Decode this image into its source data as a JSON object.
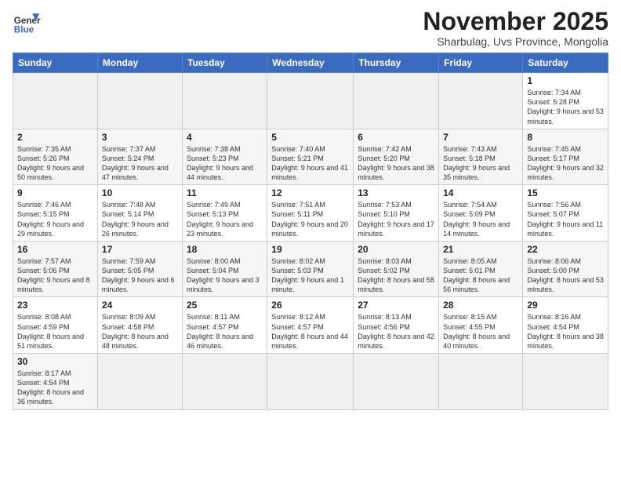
{
  "header": {
    "logo_general": "General",
    "logo_blue": "Blue",
    "month_title": "November 2025",
    "subtitle": "Sharbulag, Uvs Province, Mongolia"
  },
  "weekdays": [
    "Sunday",
    "Monday",
    "Tuesday",
    "Wednesday",
    "Thursday",
    "Friday",
    "Saturday"
  ],
  "weeks": [
    [
      {
        "day": "",
        "empty": true
      },
      {
        "day": "",
        "empty": true
      },
      {
        "day": "",
        "empty": true
      },
      {
        "day": "",
        "empty": true
      },
      {
        "day": "",
        "empty": true
      },
      {
        "day": "",
        "empty": true
      },
      {
        "day": "1",
        "info": "Sunrise: 7:34 AM\nSunset: 5:28 PM\nDaylight: 9 hours\nand 53 minutes."
      }
    ],
    [
      {
        "day": "2",
        "info": "Sunrise: 7:35 AM\nSunset: 5:26 PM\nDaylight: 9 hours\nand 50 minutes."
      },
      {
        "day": "3",
        "info": "Sunrise: 7:37 AM\nSunset: 5:24 PM\nDaylight: 9 hours\nand 47 minutes."
      },
      {
        "day": "4",
        "info": "Sunrise: 7:38 AM\nSunset: 5:23 PM\nDaylight: 9 hours\nand 44 minutes."
      },
      {
        "day": "5",
        "info": "Sunrise: 7:40 AM\nSunset: 5:21 PM\nDaylight: 9 hours\nand 41 minutes."
      },
      {
        "day": "6",
        "info": "Sunrise: 7:42 AM\nSunset: 5:20 PM\nDaylight: 9 hours\nand 38 minutes."
      },
      {
        "day": "7",
        "info": "Sunrise: 7:43 AM\nSunset: 5:18 PM\nDaylight: 9 hours\nand 35 minutes."
      },
      {
        "day": "8",
        "info": "Sunrise: 7:45 AM\nSunset: 5:17 PM\nDaylight: 9 hours\nand 32 minutes."
      }
    ],
    [
      {
        "day": "9",
        "info": "Sunrise: 7:46 AM\nSunset: 5:15 PM\nDaylight: 9 hours\nand 29 minutes."
      },
      {
        "day": "10",
        "info": "Sunrise: 7:48 AM\nSunset: 5:14 PM\nDaylight: 9 hours\nand 26 minutes."
      },
      {
        "day": "11",
        "info": "Sunrise: 7:49 AM\nSunset: 5:13 PM\nDaylight: 9 hours\nand 23 minutes."
      },
      {
        "day": "12",
        "info": "Sunrise: 7:51 AM\nSunset: 5:11 PM\nDaylight: 9 hours\nand 20 minutes."
      },
      {
        "day": "13",
        "info": "Sunrise: 7:53 AM\nSunset: 5:10 PM\nDaylight: 9 hours\nand 17 minutes."
      },
      {
        "day": "14",
        "info": "Sunrise: 7:54 AM\nSunset: 5:09 PM\nDaylight: 9 hours\nand 14 minutes."
      },
      {
        "day": "15",
        "info": "Sunrise: 7:56 AM\nSunset: 5:07 PM\nDaylight: 9 hours\nand 11 minutes."
      }
    ],
    [
      {
        "day": "16",
        "info": "Sunrise: 7:57 AM\nSunset: 5:06 PM\nDaylight: 9 hours\nand 8 minutes."
      },
      {
        "day": "17",
        "info": "Sunrise: 7:59 AM\nSunset: 5:05 PM\nDaylight: 9 hours\nand 6 minutes."
      },
      {
        "day": "18",
        "info": "Sunrise: 8:00 AM\nSunset: 5:04 PM\nDaylight: 9 hours\nand 3 minutes."
      },
      {
        "day": "19",
        "info": "Sunrise: 8:02 AM\nSunset: 5:03 PM\nDaylight: 9 hours\nand 1 minute."
      },
      {
        "day": "20",
        "info": "Sunrise: 8:03 AM\nSunset: 5:02 PM\nDaylight: 8 hours\nand 58 minutes."
      },
      {
        "day": "21",
        "info": "Sunrise: 8:05 AM\nSunset: 5:01 PM\nDaylight: 8 hours\nand 56 minutes."
      },
      {
        "day": "22",
        "info": "Sunrise: 8:06 AM\nSunset: 5:00 PM\nDaylight: 8 hours\nand 53 minutes."
      }
    ],
    [
      {
        "day": "23",
        "info": "Sunrise: 8:08 AM\nSunset: 4:59 PM\nDaylight: 8 hours\nand 51 minutes."
      },
      {
        "day": "24",
        "info": "Sunrise: 8:09 AM\nSunset: 4:58 PM\nDaylight: 8 hours\nand 48 minutes."
      },
      {
        "day": "25",
        "info": "Sunrise: 8:11 AM\nSunset: 4:57 PM\nDaylight: 8 hours\nand 46 minutes."
      },
      {
        "day": "26",
        "info": "Sunrise: 8:12 AM\nSunset: 4:57 PM\nDaylight: 8 hours\nand 44 minutes."
      },
      {
        "day": "27",
        "info": "Sunrise: 8:13 AM\nSunset: 4:56 PM\nDaylight: 8 hours\nand 42 minutes."
      },
      {
        "day": "28",
        "info": "Sunrise: 8:15 AM\nSunset: 4:55 PM\nDaylight: 8 hours\nand 40 minutes."
      },
      {
        "day": "29",
        "info": "Sunrise: 8:16 AM\nSunset: 4:54 PM\nDaylight: 8 hours\nand 38 minutes."
      }
    ],
    [
      {
        "day": "30",
        "info": "Sunrise: 8:17 AM\nSunset: 4:54 PM\nDaylight: 8 hours\nand 36 minutes."
      },
      {
        "day": "",
        "empty": true
      },
      {
        "day": "",
        "empty": true
      },
      {
        "day": "",
        "empty": true
      },
      {
        "day": "",
        "empty": true
      },
      {
        "day": "",
        "empty": true
      },
      {
        "day": "",
        "empty": true
      }
    ]
  ]
}
